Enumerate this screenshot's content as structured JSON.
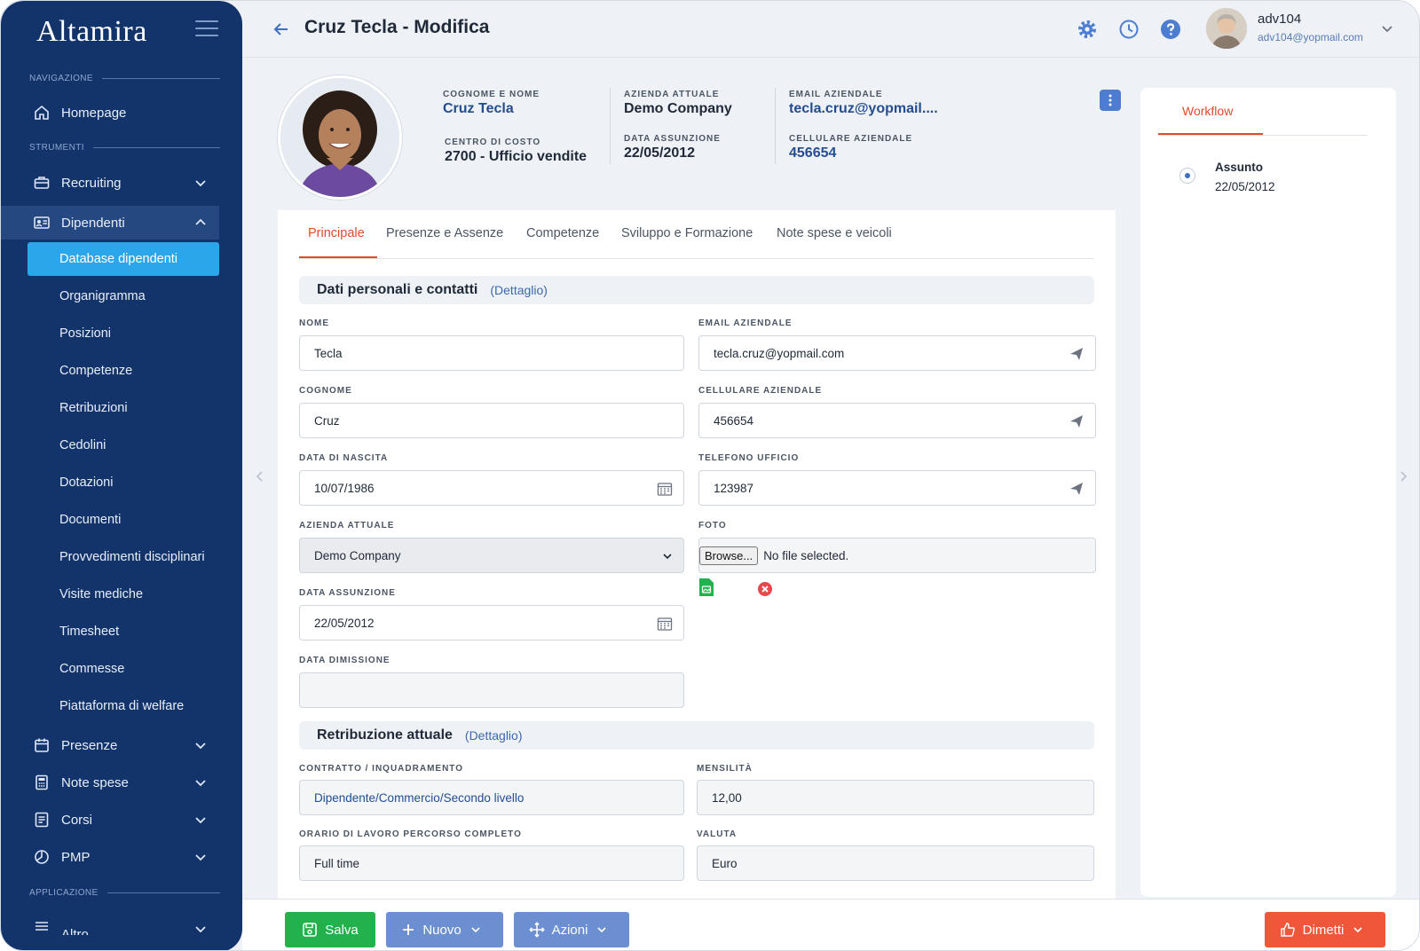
{
  "brand": "Altamira",
  "sidebar": {
    "sections": {
      "nav": "NAVIGAZIONE",
      "tools": "STRUMENTI",
      "app": "APPLICAZIONE"
    },
    "homepage": "Homepage",
    "recruiting": "Recruiting",
    "dipendenti": "Dipendenti",
    "sub_items": [
      "Database dipendenti",
      "Organigramma",
      "Posizioni",
      "Competenze",
      "Retribuzioni",
      "Cedolini",
      "Dotazioni",
      "Documenti",
      "Provvedimenti disciplinari",
      "Visite mediche",
      "Timesheet",
      "Commesse",
      "Piattaforma di welfare"
    ],
    "presenze": "Presenze",
    "note_spese": "Note spese",
    "corsi": "Corsi",
    "pmp": "PMP",
    "altro": "Altro"
  },
  "header": {
    "title": "Cruz Tecla - Modifica",
    "user_name": "adv104",
    "user_email": "adv104@yopmail.com"
  },
  "profile": {
    "name_label": "COGNOME E NOME",
    "name_value": "Cruz Tecla",
    "cost_center_label": "CENTRO DI COSTO",
    "cost_center_value": "2700 - Ufficio vendite",
    "company_label": "AZIENDA ATTUALE",
    "company_value": "Demo Company",
    "hire_label": "DATA ASSUNZIONE",
    "hire_value": "22/05/2012",
    "email_label": "EMAIL AZIENDALE",
    "email_value": "tecla.cruz@yopmail....",
    "phone_label": "CELLULARE AZIENDALE",
    "phone_value": "456654"
  },
  "workflow": {
    "tab": "Workflow",
    "status": "Assunto",
    "date": "22/05/2012"
  },
  "tabs": [
    "Principale",
    "Presenze e Assenze",
    "Competenze",
    "Sviluppo e Formazione",
    "Note spese e veicoli"
  ],
  "personal": {
    "title": "Dati personali e contatti",
    "link": "(Dettaglio)",
    "nome_label": "NOME",
    "nome_value": "Tecla",
    "cognome_label": "COGNOME",
    "cognome_value": "Cruz",
    "nascita_label": "DATA DI NASCITA",
    "nascita_value": "10/07/1986",
    "azienda_label": "AZIENDA ATTUALE",
    "azienda_value": "Demo Company",
    "assunzione_label": "DATA ASSUNZIONE",
    "assunzione_value": "22/05/2012",
    "dimissione_label": "DATA DIMISSIONE",
    "dimissione_value": "",
    "email_label": "EMAIL AZIENDALE",
    "email_value": "tecla.cruz@yopmail.com",
    "cell_label": "CELLULARE AZIENDALE",
    "cell_value": "456654",
    "tel_label": "TELEFONO UFFICIO",
    "tel_value": "123987",
    "foto_label": "FOTO",
    "browse": "Browse...",
    "no_file": "No file selected."
  },
  "salary": {
    "title": "Retribuzione attuale",
    "link": "(Dettaglio)",
    "contratto_label": "CONTRATTO / INQUADRAMENTO",
    "contratto_value": "Dipendente/Commercio/Secondo livello",
    "mensilita_label": "MENSILITÀ",
    "mensilita_value": "12,00",
    "orario_label": "ORARIO DI LAVORO PERCORSO COMPLETO",
    "orario_value": "Full time",
    "valuta_label": "VALUTA",
    "valuta_value": "Euro"
  },
  "footer": {
    "salva": "Salva",
    "nuovo": "Nuovo",
    "azioni": "Azioni",
    "dimetti": "Dimetti"
  },
  "colors": {
    "sidebar": "#13346b",
    "accent_active": "#2ba6ea",
    "tab_active": "#e34a2b",
    "save": "#22b14c",
    "action": "#6b8fd0",
    "dismiss": "#f0573a"
  }
}
